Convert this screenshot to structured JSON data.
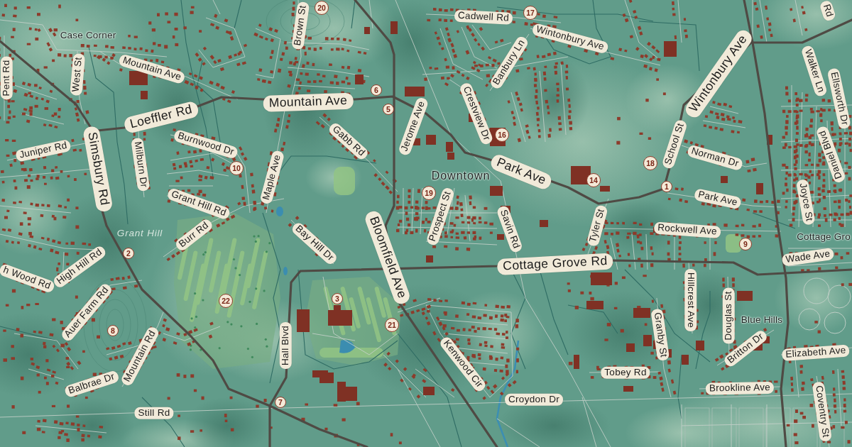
{
  "map": {
    "street_labels": [
      {
        "text": "Brown St",
        "kind": "minor"
      },
      {
        "text": "Cadwell Rd",
        "kind": "minor"
      },
      {
        "text": "Rd",
        "kind": "minor"
      },
      {
        "text": "Wintonbury Ave",
        "kind": "minor"
      },
      {
        "text": "Mountain Ave",
        "kind": "minor"
      },
      {
        "text": "West St",
        "kind": "minor"
      },
      {
        "text": "Pent Rd",
        "kind": "minor"
      },
      {
        "text": "Banbury Ln",
        "kind": "minor"
      },
      {
        "text": "Wintonbury Ave",
        "kind": "major"
      },
      {
        "text": "Walker Ln",
        "kind": "minor"
      },
      {
        "text": "Ellsworth Dr",
        "kind": "minor"
      },
      {
        "text": "Mountain Ave",
        "kind": "major"
      },
      {
        "text": "Crestview Dr",
        "kind": "minor"
      },
      {
        "text": "Loeffler Rd",
        "kind": "major"
      },
      {
        "text": "Jerome Ave",
        "kind": "minor"
      },
      {
        "text": "Gabb Rd",
        "kind": "minor"
      },
      {
        "text": "School St",
        "kind": "minor"
      },
      {
        "text": "Burnwood Dr",
        "kind": "minor"
      },
      {
        "text": "Juniper Rd",
        "kind": "minor"
      },
      {
        "text": "Daniel Blvd",
        "kind": "minor"
      },
      {
        "text": "Norman Dr",
        "kind": "minor"
      },
      {
        "text": "Milburn Dr",
        "kind": "minor"
      },
      {
        "text": "Simsbury Rd",
        "kind": "major"
      },
      {
        "text": "Park Ave",
        "kind": "major"
      },
      {
        "text": "Maple Ave",
        "kind": "minor"
      },
      {
        "text": "Park Ave",
        "kind": "minor"
      },
      {
        "text": "Joyce St",
        "kind": "minor"
      },
      {
        "text": "Grant Hill Rd",
        "kind": "minor"
      },
      {
        "text": "Prospect St",
        "kind": "minor"
      },
      {
        "text": "Tyler St",
        "kind": "minor"
      },
      {
        "text": "Savin Rd",
        "kind": "minor"
      },
      {
        "text": "Rockwell Ave",
        "kind": "minor"
      },
      {
        "text": "Burr Rd",
        "kind": "minor"
      },
      {
        "text": "Bay Hill Dr",
        "kind": "minor"
      },
      {
        "text": "Bloomfield Ave",
        "kind": "major"
      },
      {
        "text": "Wade Ave",
        "kind": "minor"
      },
      {
        "text": "Cottage Grove Rd",
        "kind": "major"
      },
      {
        "text": "High Hill Rd",
        "kind": "minor"
      },
      {
        "text": "h Wood Rd",
        "kind": "minor"
      },
      {
        "text": "Hillcrest Ave",
        "kind": "minor"
      },
      {
        "text": "Auer Farm Rd",
        "kind": "minor"
      },
      {
        "text": "Douglas St",
        "kind": "minor"
      },
      {
        "text": "Granby St",
        "kind": "minor"
      },
      {
        "text": "Hall Blvd",
        "kind": "minor"
      },
      {
        "text": "Britton Dr",
        "kind": "minor"
      },
      {
        "text": "Elizabeth Ave",
        "kind": "minor"
      },
      {
        "text": "Mountain Rd",
        "kind": "minor"
      },
      {
        "text": "Kenwood Cir",
        "kind": "minor"
      },
      {
        "text": "Tobey Rd",
        "kind": "minor"
      },
      {
        "text": "Balbrae Dr",
        "kind": "minor"
      },
      {
        "text": "Brookline Ave",
        "kind": "minor"
      },
      {
        "text": "Croydon Dr",
        "kind": "minor"
      },
      {
        "text": "Coventry St",
        "kind": "minor"
      },
      {
        "text": "Still Rd",
        "kind": "minor"
      }
    ],
    "place_labels": [
      {
        "text": "Case Corner",
        "kind": "locality"
      },
      {
        "text": "Downtown",
        "kind": "town"
      },
      {
        "text": "Grant Hill",
        "kind": "hill"
      },
      {
        "text": "Cottage Gro",
        "kind": "locality"
      },
      {
        "text": "Blue Hills",
        "kind": "locality"
      }
    ],
    "markers": [
      {
        "number": "20"
      },
      {
        "number": "17"
      },
      {
        "number": "6"
      },
      {
        "number": "5"
      },
      {
        "number": "16"
      },
      {
        "number": "18"
      },
      {
        "number": "10"
      },
      {
        "number": "14"
      },
      {
        "number": "1"
      },
      {
        "number": "19"
      },
      {
        "number": "9"
      },
      {
        "number": "2"
      },
      {
        "number": "3"
      },
      {
        "number": "22"
      },
      {
        "number": "21"
      },
      {
        "number": "8"
      },
      {
        "number": "7"
      }
    ]
  }
}
